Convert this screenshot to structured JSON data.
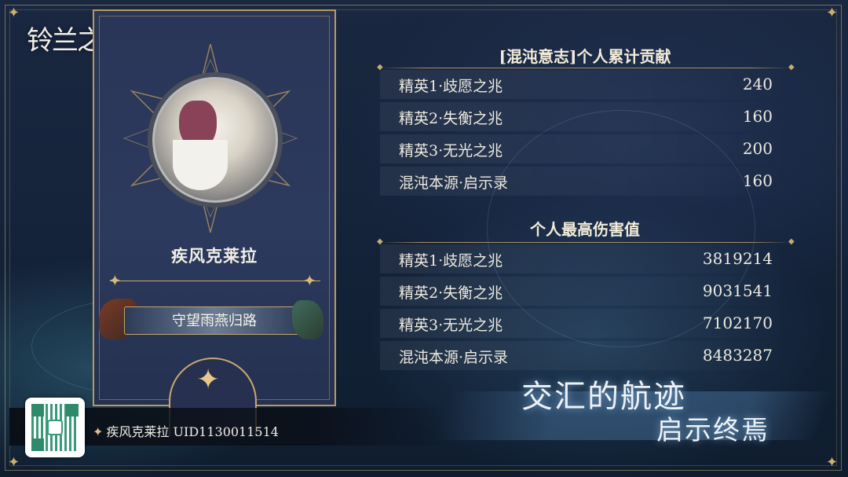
{
  "logo": "铃兰之剑",
  "character": {
    "name": "疾风克莱拉",
    "title": "守望雨燕归路"
  },
  "footer": {
    "player": "疾风克莱拉",
    "uid": "UID1130011514"
  },
  "contribution": {
    "heading": "[混沌意志]个人累计贡献",
    "rows": [
      {
        "label": "精英1·歧愿之兆",
        "value": "240"
      },
      {
        "label": "精英2·失衡之兆",
        "value": "160"
      },
      {
        "label": "精英3·无光之兆",
        "value": "200"
      },
      {
        "label": "混沌本源·启示录",
        "value": "160"
      }
    ]
  },
  "damage": {
    "heading": "个人最高伤害值",
    "rows": [
      {
        "label": "精英1·歧愿之兆",
        "value": "3819214"
      },
      {
        "label": "精英2·失衡之兆",
        "value": "9031541"
      },
      {
        "label": "精英3·无光之兆",
        "value": "7102170"
      },
      {
        "label": "混沌本源·启示录",
        "value": "8483287"
      }
    ]
  },
  "slogan": {
    "line1": "交汇的航迹",
    "line2": "启示终焉"
  },
  "icons": [
    "star-icon",
    "qr-code-icon",
    "diamond-icon"
  ],
  "colors": {
    "gold": "#c9aa6e",
    "panel": "#2a3658",
    "text": "#eeeae0"
  }
}
